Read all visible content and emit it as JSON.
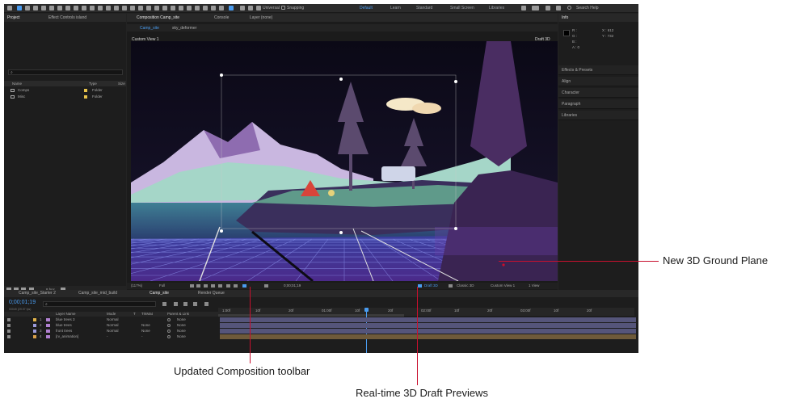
{
  "toolbar": {
    "universal_label": "Universal",
    "snapping_label": "Snapping",
    "workspaces": [
      "Default",
      "Learn",
      "Standard",
      "Small Screen",
      "Libraries"
    ],
    "search_placeholder": "Search Help"
  },
  "project": {
    "tabs": [
      "Project",
      "Effect Controls island"
    ],
    "columns": [
      "Name",
      "Type",
      "Size"
    ],
    "items": [
      {
        "name": "Comps",
        "type": "Folder"
      },
      {
        "name": "Misc",
        "type": "Folder"
      }
    ],
    "bpc": "8 bpc"
  },
  "composition": {
    "tabs": [
      "Composition Camp_site",
      "Console",
      "Layer (none)"
    ],
    "subtabs": [
      "Camp_site",
      "sky_deformer"
    ],
    "view_label": "Custom View 1",
    "renderer_label": "Draft 3D",
    "footer": {
      "zoom": "(117%)",
      "resolution": "Full",
      "timecode": "0;00;01;19",
      "draft3d": "Draft 3D",
      "classic3d": "Classic 3D",
      "view": "Custom View 1",
      "views": "1 View"
    }
  },
  "info": {
    "title": "Info",
    "r": "R :",
    "g": "G :",
    "b": "B :",
    "a": "A : 0",
    "x": "X : 612",
    "y": "Y : 732"
  },
  "right_panels": [
    "Effects & Presets",
    "Align",
    "Character",
    "Paragraph",
    "Libraries"
  ],
  "timeline": {
    "tabs": [
      "Camp_site_Starter 2",
      "Camp_site_mid_build",
      "Camp_site",
      "Render Queue"
    ],
    "timecode": "0;00;01;19",
    "timecode_sub": "00049 (29.97 fps)",
    "columns": [
      "Layer Name",
      "Mode",
      "T",
      "TrkMat",
      "Parent & Link"
    ],
    "layers": [
      {
        "num": "1",
        "name": "blue trees 3",
        "mode": "Normal",
        "trkmat": "",
        "parent": "None",
        "color": "#e0b24a"
      },
      {
        "num": "2",
        "name": "blue trees",
        "mode": "Normal",
        "trkmat": "None",
        "parent": "None",
        "color": "#9b9bdc"
      },
      {
        "num": "3",
        "name": "front trees",
        "mode": "Normal",
        "trkmat": "None",
        "parent": "None",
        "color": "#9b9bdc"
      },
      {
        "num": "4",
        "name": "[rv_animation]",
        "mode": "-",
        "trkmat": "-",
        "parent": "None",
        "color": "#d8a04a"
      }
    ],
    "ruler": [
      "1:00f",
      "10f",
      "20f",
      "01:00f",
      "10f",
      "20f",
      "02:00f",
      "10f",
      "20f",
      "03:00f",
      "10f",
      "20f"
    ]
  },
  "callouts": {
    "ground_plane": "New 3D Ground Plane",
    "comp_toolbar": "Updated Composition toolbar",
    "draft_previews": "Real-time 3D Draft Previews"
  },
  "colors": {
    "accent": "#4a9cf0",
    "callout_line": "#c8102e"
  }
}
